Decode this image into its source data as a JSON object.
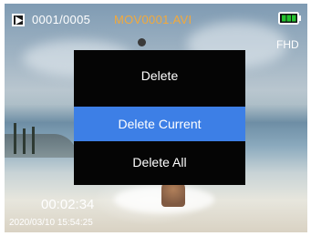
{
  "topbar": {
    "mode_icon": "playback-icon",
    "file_index": "0001/0005",
    "file_name": "MOV0001.AVI",
    "file_name_color": "#f2a93b",
    "battery_icon": "battery-full-icon",
    "battery_color": "#25c22f"
  },
  "resolution": "FHD",
  "menu": {
    "title": "Delete",
    "items": [
      {
        "label": "Delete Current",
        "selected": true
      },
      {
        "label": "Delete All",
        "selected": false
      }
    ],
    "selected_color": "#3d7fe6"
  },
  "playback": {
    "elapsed": "00:02:34",
    "timestamp": "2020/03/10 15:54:25"
  }
}
